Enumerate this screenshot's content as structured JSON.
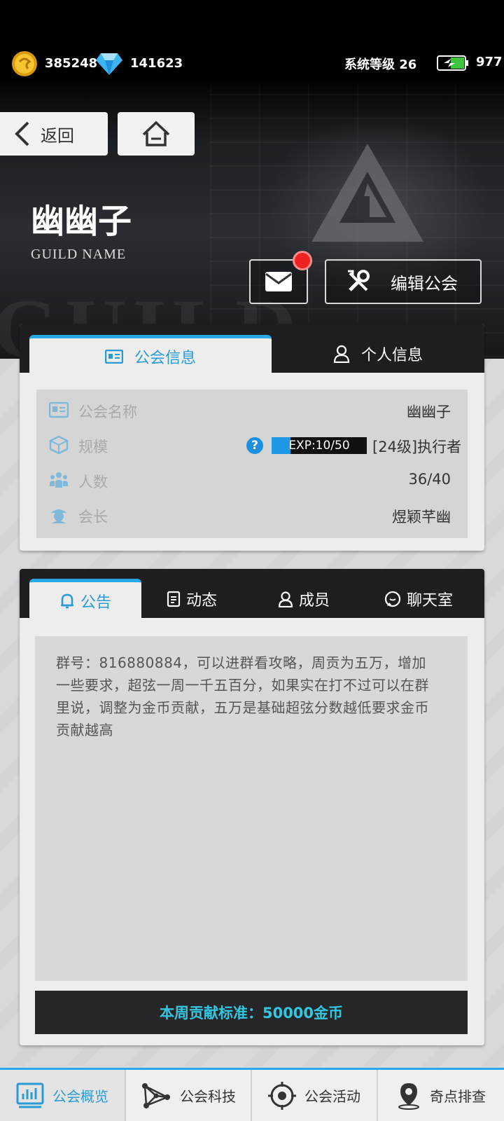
{
  "currency": {
    "coins": "385248",
    "gems": "141623",
    "system_level": "系统等级 26",
    "energy": "977"
  },
  "nav": {
    "back_label": "返回"
  },
  "guild": {
    "name": "幽幽子",
    "subtitle": "GUILD NAME"
  },
  "actions": {
    "edit_label": "编辑公会"
  },
  "info_tabs": [
    {
      "label": "公会信息",
      "active": true
    },
    {
      "label": "个人信息",
      "active": false
    }
  ],
  "info": {
    "name_label": "公会名称",
    "name_value": "幽幽子",
    "scale_label": "规模",
    "exp_text": "EXP:10/50",
    "exp_fraction": 0.2,
    "scale_value": "[24级]执行者",
    "members_label": "人数",
    "members_value": "36/40",
    "leader_label": "会长",
    "leader_value": "煜颖芊幽"
  },
  "ann_tabs": [
    {
      "label": "公告",
      "active": true
    },
    {
      "label": "动态",
      "active": false
    },
    {
      "label": "成员",
      "active": false
    },
    {
      "label": "聊天室",
      "active": false
    }
  ],
  "announcement": {
    "text": "群号：816880884，可以进群看攻略，周贡为五万，增加一些要求，超弦一周一千五百分，如果实在打不过可以在群里说，调整为金币贡献，五万是基础超弦分数越低要求金币贡献越高"
  },
  "contribution": {
    "text": "本周贡献标准：50000金币"
  },
  "bottom_nav": [
    {
      "label": "公会概览",
      "active": true
    },
    {
      "label": "公会科技",
      "active": false
    },
    {
      "label": "公会活动",
      "active": false
    },
    {
      "label": "奇点排查",
      "active": false
    }
  ],
  "colors": {
    "accent": "#2aa7e6",
    "contribution_text": "#33c6e0",
    "dark": "#1e1e20"
  }
}
